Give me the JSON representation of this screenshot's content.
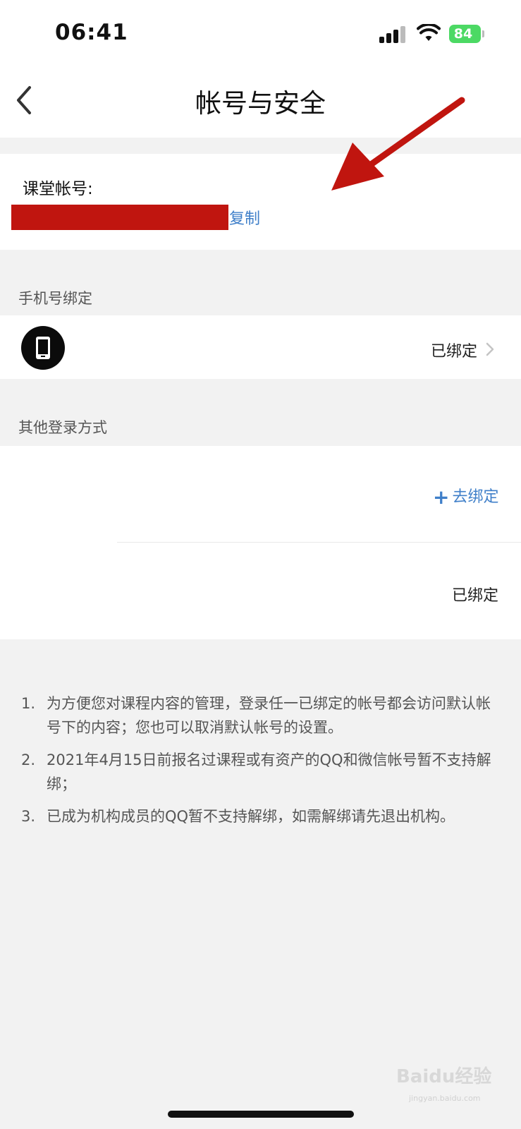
{
  "status_bar": {
    "time": "06:41",
    "battery": "84"
  },
  "nav": {
    "title": "帐号与安全"
  },
  "account": {
    "label": "课堂帐号:",
    "copy_label": "复制"
  },
  "phone_section": {
    "header": "手机号绑定",
    "status": "已绑定"
  },
  "other_section": {
    "header": "其他登录方式",
    "rows": [
      {
        "action": "去绑定"
      },
      {
        "status": "已绑定"
      }
    ]
  },
  "notes": [
    {
      "num": "1.",
      "text": "为方便您对课程内容的管理，登录任一已绑定的帐号都会访问默认帐号下的内容；您也可以取消默认帐号的设置。"
    },
    {
      "num": "2.",
      "text": "2021年4月15日前报名过课程或有资产的QQ和微信帐号暂不支持解绑；"
    },
    {
      "num": "3.",
      "text": "已成为机构成员的QQ暂不支持解绑，如需解绑请先退出机构。"
    }
  ],
  "watermark": {
    "brand": "Baidu经验",
    "url": "jingyan.baidu.com"
  },
  "colors": {
    "accent": "#3f7fc9",
    "redaction": "#c0150f",
    "annotation_arrow": "#c0150f",
    "battery": "#4cd964"
  },
  "icons": [
    "back-chevron-icon",
    "cellular-signal-icon",
    "wifi-icon",
    "battery-icon",
    "phone-icon",
    "chevron-right-icon",
    "plus-icon"
  ]
}
